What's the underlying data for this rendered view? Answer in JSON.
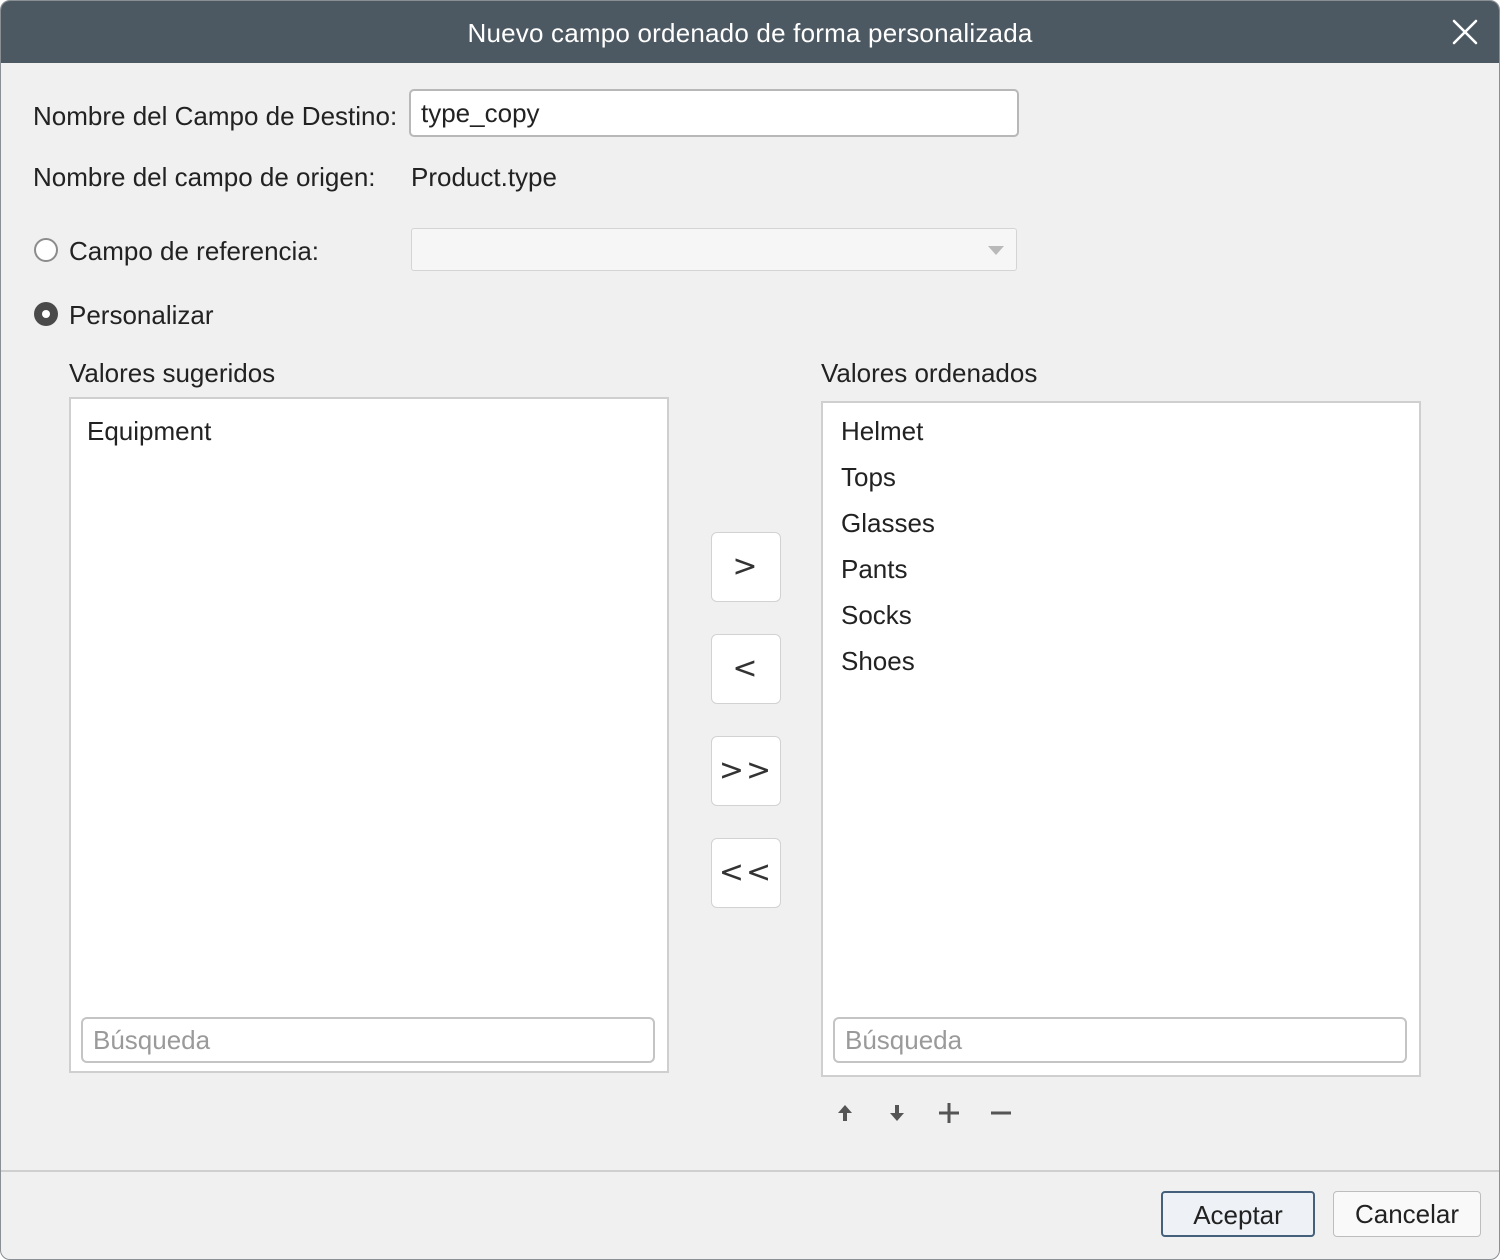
{
  "dialog": {
    "title": "Nuevo campo ordenado de forma personalizada",
    "close_icon": "close-icon"
  },
  "form": {
    "target_label": "Nombre del Campo de Destino:",
    "target_value": "type_copy",
    "source_label": "Nombre del campo de origen:",
    "source_value": "Product.type",
    "reference_label": "Campo de referencia:",
    "reference_selected": false,
    "reference_value": "",
    "custom_label": "Personalizar",
    "custom_selected": true
  },
  "suggested": {
    "header": "Valores sugeridos",
    "items": [
      "Equipment"
    ],
    "search_placeholder": "Búsqueda"
  },
  "ordered": {
    "header": "Valores ordenados",
    "items": [
      "Helmet",
      "Tops",
      "Glasses",
      "Pants",
      "Socks",
      "Shoes"
    ],
    "search_placeholder": "Búsqueda"
  },
  "move_buttons": {
    "move_right": ">",
    "move_left": "<",
    "move_all_right": ">>",
    "move_all_left": "<<"
  },
  "toolbar_icons": [
    "arrow-up-icon",
    "arrow-down-icon",
    "plus-icon",
    "minus-icon"
  ],
  "footer": {
    "ok_label": "Aceptar",
    "cancel_label": "Cancelar"
  },
  "colors": {
    "titlebar": "#4d5962",
    "background": "#f0f0f0",
    "primary_border": "#44607a"
  }
}
